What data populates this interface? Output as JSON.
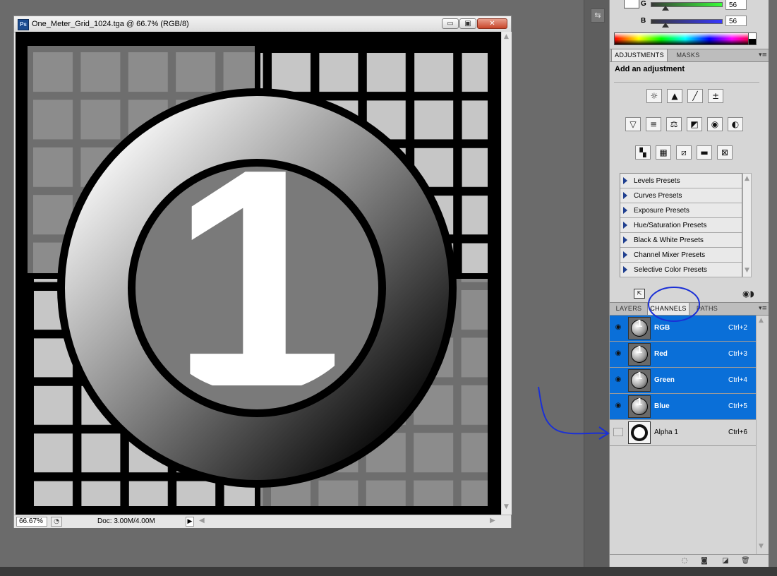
{
  "document": {
    "title": "One_Meter_Grid_1024.tga @ 66.7% (RGB/8)",
    "app_icon": "Ps",
    "buttons": {
      "minimize": "▭",
      "maximize": "▣",
      "close": "✕"
    },
    "canvas_number": "1",
    "status": {
      "zoom": "66.67%",
      "doc_size": "Doc: 3.00M/4.00M",
      "menu_arrow": "▶"
    }
  },
  "color_panel": {
    "channels": [
      {
        "label": "G",
        "value": "56",
        "thumb_fraction": 0.2
      },
      {
        "label": "B",
        "value": "56",
        "thumb_fraction": 0.2
      }
    ]
  },
  "adjustments": {
    "tabs": [
      "ADJUSTMENTS",
      "MASKS"
    ],
    "active_tab": "ADJUSTMENTS",
    "heading": "Add an adjustment",
    "icon_rows": [
      [
        "brightness-contrast-icon",
        "levels-icon",
        "curves-icon",
        "exposure-icon"
      ],
      [
        "vibrance-icon",
        "hue-saturation-icon",
        "color-balance-icon",
        "black-white-icon",
        "photo-filter-icon",
        "channel-mixer-icon"
      ],
      [
        "invert-icon",
        "posterize-icon",
        "threshold-icon",
        "gradient-map-icon",
        "selective-color-icon"
      ]
    ],
    "icon_glyphs": [
      [
        "☼",
        "▲",
        "╱",
        "±"
      ],
      [
        "▽",
        "≡",
        "⚖",
        "◩",
        "◉",
        "◐"
      ],
      [
        "▚",
        "▦",
        "⧄",
        "▬",
        "⊠"
      ]
    ],
    "presets": [
      "Levels Presets",
      "Curves Presets",
      "Exposure Presets",
      "Hue/Saturation Presets",
      "Black & White Presets",
      "Channel Mixer Presets",
      "Selective Color Presets"
    ]
  },
  "channels_panel": {
    "tabs": [
      "LAYERS",
      "CHANNELS",
      "PATHS"
    ],
    "active_tab": "CHANNELS",
    "channels": [
      {
        "name": "RGB",
        "shortcut": "Ctrl+2",
        "visible": true,
        "selected": true
      },
      {
        "name": "Red",
        "shortcut": "Ctrl+3",
        "visible": true,
        "selected": true
      },
      {
        "name": "Green",
        "shortcut": "Ctrl+4",
        "visible": true,
        "selected": true
      },
      {
        "name": "Blue",
        "shortcut": "Ctrl+5",
        "visible": true,
        "selected": true
      },
      {
        "name": "Alpha 1",
        "shortcut": "Ctrl+6",
        "visible": false,
        "selected": false
      }
    ],
    "footer_icons": [
      "load-selection-icon",
      "save-selection-icon",
      "new-channel-icon",
      "delete-channel-icon"
    ]
  },
  "colors": {
    "selection": "#0a6fd8",
    "annotation_ink": "#1a2fd6",
    "workspace": "#6b6b6b"
  }
}
